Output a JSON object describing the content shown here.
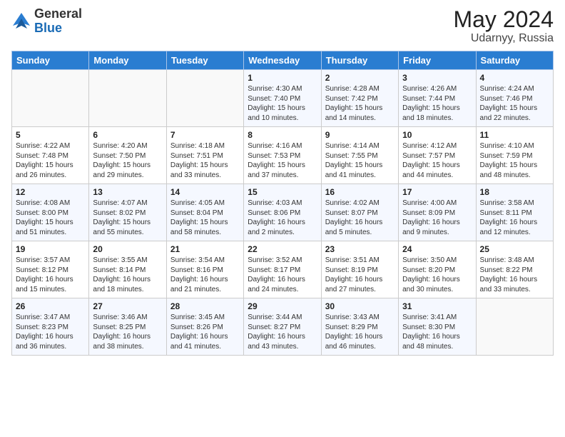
{
  "logo": {
    "general": "General",
    "blue": "Blue"
  },
  "title": {
    "month_year": "May 2024",
    "location": "Udarnyy, Russia"
  },
  "weekdays": [
    "Sunday",
    "Monday",
    "Tuesday",
    "Wednesday",
    "Thursday",
    "Friday",
    "Saturday"
  ],
  "weeks": [
    [
      {
        "day": "",
        "info": ""
      },
      {
        "day": "",
        "info": ""
      },
      {
        "day": "",
        "info": ""
      },
      {
        "day": "1",
        "info": "Sunrise: 4:30 AM\nSunset: 7:40 PM\nDaylight: 15 hours\nand 10 minutes."
      },
      {
        "day": "2",
        "info": "Sunrise: 4:28 AM\nSunset: 7:42 PM\nDaylight: 15 hours\nand 14 minutes."
      },
      {
        "day": "3",
        "info": "Sunrise: 4:26 AM\nSunset: 7:44 PM\nDaylight: 15 hours\nand 18 minutes."
      },
      {
        "day": "4",
        "info": "Sunrise: 4:24 AM\nSunset: 7:46 PM\nDaylight: 15 hours\nand 22 minutes."
      }
    ],
    [
      {
        "day": "5",
        "info": "Sunrise: 4:22 AM\nSunset: 7:48 PM\nDaylight: 15 hours\nand 26 minutes."
      },
      {
        "day": "6",
        "info": "Sunrise: 4:20 AM\nSunset: 7:50 PM\nDaylight: 15 hours\nand 29 minutes."
      },
      {
        "day": "7",
        "info": "Sunrise: 4:18 AM\nSunset: 7:51 PM\nDaylight: 15 hours\nand 33 minutes."
      },
      {
        "day": "8",
        "info": "Sunrise: 4:16 AM\nSunset: 7:53 PM\nDaylight: 15 hours\nand 37 minutes."
      },
      {
        "day": "9",
        "info": "Sunrise: 4:14 AM\nSunset: 7:55 PM\nDaylight: 15 hours\nand 41 minutes."
      },
      {
        "day": "10",
        "info": "Sunrise: 4:12 AM\nSunset: 7:57 PM\nDaylight: 15 hours\nand 44 minutes."
      },
      {
        "day": "11",
        "info": "Sunrise: 4:10 AM\nSunset: 7:59 PM\nDaylight: 15 hours\nand 48 minutes."
      }
    ],
    [
      {
        "day": "12",
        "info": "Sunrise: 4:08 AM\nSunset: 8:00 PM\nDaylight: 15 hours\nand 51 minutes."
      },
      {
        "day": "13",
        "info": "Sunrise: 4:07 AM\nSunset: 8:02 PM\nDaylight: 15 hours\nand 55 minutes."
      },
      {
        "day": "14",
        "info": "Sunrise: 4:05 AM\nSunset: 8:04 PM\nDaylight: 15 hours\nand 58 minutes."
      },
      {
        "day": "15",
        "info": "Sunrise: 4:03 AM\nSunset: 8:06 PM\nDaylight: 16 hours\nand 2 minutes."
      },
      {
        "day": "16",
        "info": "Sunrise: 4:02 AM\nSunset: 8:07 PM\nDaylight: 16 hours\nand 5 minutes."
      },
      {
        "day": "17",
        "info": "Sunrise: 4:00 AM\nSunset: 8:09 PM\nDaylight: 16 hours\nand 9 minutes."
      },
      {
        "day": "18",
        "info": "Sunrise: 3:58 AM\nSunset: 8:11 PM\nDaylight: 16 hours\nand 12 minutes."
      }
    ],
    [
      {
        "day": "19",
        "info": "Sunrise: 3:57 AM\nSunset: 8:12 PM\nDaylight: 16 hours\nand 15 minutes."
      },
      {
        "day": "20",
        "info": "Sunrise: 3:55 AM\nSunset: 8:14 PM\nDaylight: 16 hours\nand 18 minutes."
      },
      {
        "day": "21",
        "info": "Sunrise: 3:54 AM\nSunset: 8:16 PM\nDaylight: 16 hours\nand 21 minutes."
      },
      {
        "day": "22",
        "info": "Sunrise: 3:52 AM\nSunset: 8:17 PM\nDaylight: 16 hours\nand 24 minutes."
      },
      {
        "day": "23",
        "info": "Sunrise: 3:51 AM\nSunset: 8:19 PM\nDaylight: 16 hours\nand 27 minutes."
      },
      {
        "day": "24",
        "info": "Sunrise: 3:50 AM\nSunset: 8:20 PM\nDaylight: 16 hours\nand 30 minutes."
      },
      {
        "day": "25",
        "info": "Sunrise: 3:48 AM\nSunset: 8:22 PM\nDaylight: 16 hours\nand 33 minutes."
      }
    ],
    [
      {
        "day": "26",
        "info": "Sunrise: 3:47 AM\nSunset: 8:23 PM\nDaylight: 16 hours\nand 36 minutes."
      },
      {
        "day": "27",
        "info": "Sunrise: 3:46 AM\nSunset: 8:25 PM\nDaylight: 16 hours\nand 38 minutes."
      },
      {
        "day": "28",
        "info": "Sunrise: 3:45 AM\nSunset: 8:26 PM\nDaylight: 16 hours\nand 41 minutes."
      },
      {
        "day": "29",
        "info": "Sunrise: 3:44 AM\nSunset: 8:27 PM\nDaylight: 16 hours\nand 43 minutes."
      },
      {
        "day": "30",
        "info": "Sunrise: 3:43 AM\nSunset: 8:29 PM\nDaylight: 16 hours\nand 46 minutes."
      },
      {
        "day": "31",
        "info": "Sunrise: 3:41 AM\nSunset: 8:30 PM\nDaylight: 16 hours\nand 48 minutes."
      },
      {
        "day": "",
        "info": ""
      }
    ]
  ]
}
